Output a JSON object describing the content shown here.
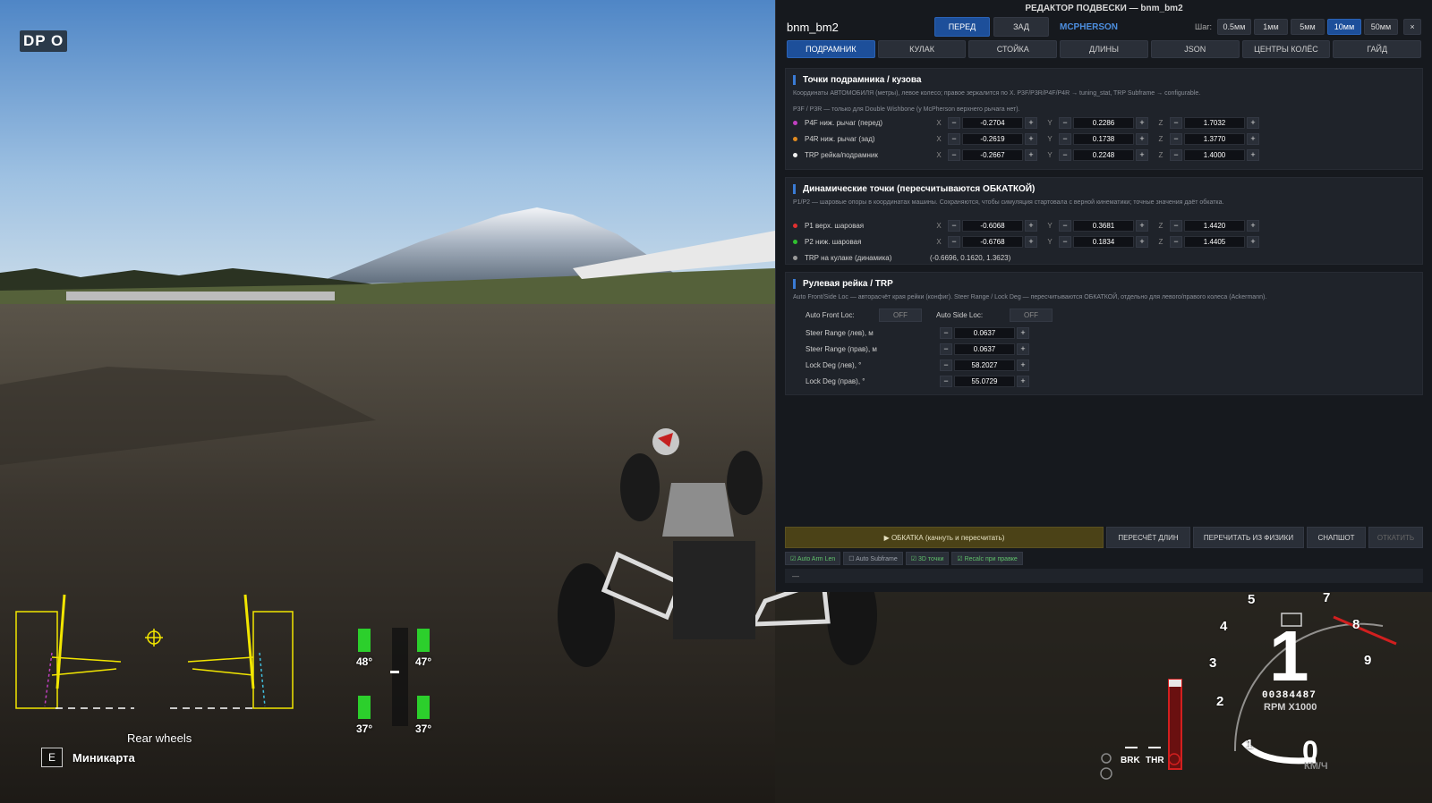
{
  "hud": {
    "logo": "DP O",
    "rear_label": "Rear wheels",
    "minimap_key": "E",
    "minimap_label": "Миникарта",
    "tire_temps": {
      "fl": "48°",
      "fr": "47°",
      "rl": "37°",
      "rr": "37°"
    },
    "gear": "1",
    "odometer": "00384487",
    "rpm_label": "RPM X1000",
    "speed": "0",
    "speed_unit": "КМ/Ч",
    "tach_numbers": [
      "1",
      "2",
      "3",
      "4",
      "5",
      "7",
      "8",
      "9"
    ],
    "brk_label": "BRK",
    "thr_label": "THR",
    "colors": {
      "overlay_yellow": "#f2e600",
      "rpm_red": "#d21f1f",
      "tire_green": "#2ccf2c"
    }
  },
  "panel": {
    "title": "РЕДАКТОР ПОДВЕСКИ — bnm_bm2",
    "car": "bnm_bm2",
    "axle_front": "ПЕРЕД",
    "axle_rear": "ЗАД",
    "mode": "MCPHERSON",
    "step_label": "Шаг:",
    "steps": [
      "0.5мм",
      "1мм",
      "5мм",
      "10мм",
      "50мм"
    ],
    "active_step": "10мм",
    "close": "×",
    "tabs": [
      "ПОДРАМНИК",
      "КУЛАК",
      "СТОЙКА",
      "ДЛИНЫ",
      "JSON",
      "ЦЕНТРЫ КОЛЁС",
      "ГАЙД"
    ],
    "active_tab": "ПОДРАМНИК",
    "sections": {
      "subframe": {
        "title": "Точки подрамника / кузова",
        "desc1": "Координаты АВТОМОБИЛЯ (метры), левое колесо; правое зеркалится по X. P3F/P3R/P4F/P4R → tuning_stat, TRP Subframe → configurable.",
        "desc2": "P3F / P3R — только для Double Wishbone (у McPherson верхнего рычага нет).",
        "rows": [
          {
            "label": "P4F ниж. рычаг (перед)",
            "color": "#c040c0",
            "x": "-0.2704",
            "y": "0.2286",
            "z": "1.7032"
          },
          {
            "label": "P4R ниж. рычаг (зад)",
            "color": "#e08a20",
            "x": "-0.2619",
            "y": "0.1738",
            "z": "1.3770"
          },
          {
            "label": "TRP рейка/подрамник",
            "color": "#f0f0f0",
            "x": "-0.2667",
            "y": "0.2248",
            "z": "1.4000"
          }
        ]
      },
      "dynamic": {
        "title": "Динамические точки (пересчитываются ОБКАТКОЙ)",
        "desc": "P1/P2 — шаровые опоры в координатах машины. Сохраняются, чтобы симуляция стартовала с верной кинематики; точные значения даёт обкатка.",
        "rows": [
          {
            "label": "P1 верх. шаровая",
            "color": "#e03030",
            "x": "-0.6068",
            "y": "0.3681",
            "z": "1.4420"
          },
          {
            "label": "P2 ниж. шаровая",
            "color": "#30c030",
            "x": "-0.6768",
            "y": "0.1834",
            "z": "1.4405"
          }
        ],
        "trp_label": "TRP на кулаке (динамика)",
        "trp_color": "#9a9a9a",
        "trp_value": "(-0.6696, 0.1620, 1.3623)"
      },
      "steer": {
        "title": "Рулевая рейка / TRP",
        "desc": "Auto Front/Side Loc — авторасчёт края рейки (конфиг). Steer Range / Lock Deg — пересчитываются ОБКАТКОЙ, отдельно для левого/правого колеса (Ackermann).",
        "auto_front_label": "Auto Front Loc:",
        "auto_front_value": "OFF",
        "auto_side_label": "Auto Side Loc:",
        "auto_side_value": "OFF",
        "rows": [
          {
            "label": "Steer Range (лев), м",
            "value": "0.0637"
          },
          {
            "label": "Steer Range (прав), м",
            "value": "0.0637"
          },
          {
            "label": "Lock Deg (лев), °",
            "value": "58.2027"
          },
          {
            "label": "Lock Deg (прав), °",
            "value": "55.0729"
          }
        ]
      }
    },
    "actions": {
      "run": "▶ ОБКАТКА (качнуть и пересчитать)",
      "recalc": "ПЕРЕСЧЁТ ДЛИН",
      "reread": "ПЕРЕЧИТАТЬ ИЗ ФИЗИКИ",
      "snapshot": "СНАПШОТ",
      "rollback": "ОТКАТИТЬ"
    },
    "toggles": [
      {
        "label": "☑ Auto Arm Len",
        "on": true
      },
      {
        "label": "☐ Auto Subframe",
        "on": false
      },
      {
        "label": "☑ 3D точки",
        "on": true
      },
      {
        "label": "☑ Recalc при правке",
        "on": true
      }
    ],
    "status": "—"
  }
}
